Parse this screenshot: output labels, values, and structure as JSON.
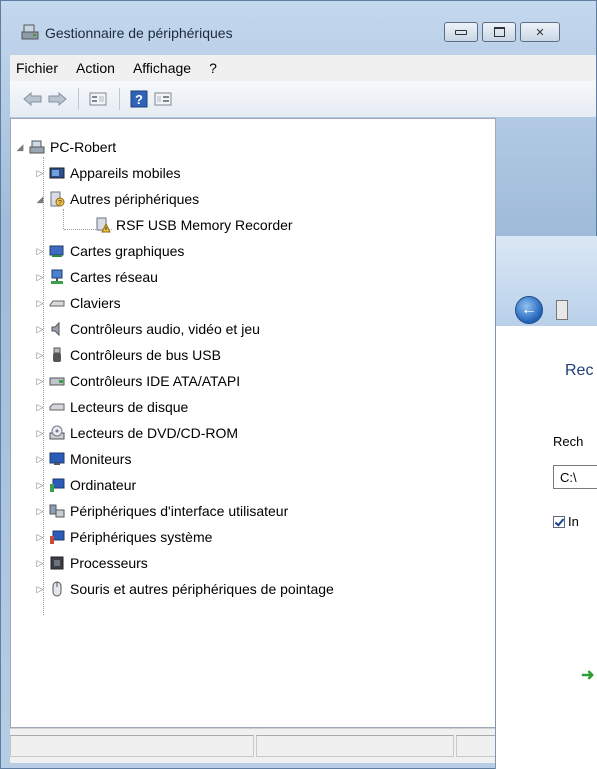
{
  "window": {
    "title": "Gestionnaire de périphériques",
    "buttons": {
      "minimize": "minimize-icon",
      "maximize": "maximize-icon",
      "close": "close-icon"
    }
  },
  "menu": {
    "items": [
      "Fichier",
      "Action",
      "Affichage",
      "?"
    ]
  },
  "toolbar": {
    "icons": [
      "back-arrow-icon",
      "forward-arrow-icon",
      "properties-icon",
      "help-icon",
      "view-icon"
    ]
  },
  "tree": {
    "root": "PC-Robert",
    "items": [
      {
        "label": "Appareils mobiles",
        "icon": "mobile-device-icon",
        "expanded": false
      },
      {
        "label": "Autres périphériques",
        "icon": "unknown-device-icon",
        "expanded": true,
        "children": [
          {
            "label": "RSF USB Memory Recorder",
            "icon": "warning-device-icon"
          }
        ]
      },
      {
        "label": "Cartes graphiques",
        "icon": "display-adapter-icon",
        "expanded": false
      },
      {
        "label": "Cartes réseau",
        "icon": "network-adapter-icon",
        "expanded": false
      },
      {
        "label": "Claviers",
        "icon": "keyboard-icon",
        "expanded": false
      },
      {
        "label": "Contrôleurs audio, vidéo et jeu",
        "icon": "speaker-icon",
        "expanded": false
      },
      {
        "label": "Contrôleurs de bus USB",
        "icon": "usb-icon",
        "expanded": false
      },
      {
        "label": "Contrôleurs IDE ATA/ATAPI",
        "icon": "ide-controller-icon",
        "expanded": false
      },
      {
        "label": "Lecteurs de disque",
        "icon": "disk-drive-icon",
        "expanded": false
      },
      {
        "label": "Lecteurs de DVD/CD-ROM",
        "icon": "dvd-drive-icon",
        "expanded": false
      },
      {
        "label": "Moniteurs",
        "icon": "monitor-icon",
        "expanded": false
      },
      {
        "label": "Ordinateur",
        "icon": "computer-icon",
        "expanded": false
      },
      {
        "label": "Périphériques d'interface utilisateur",
        "icon": "hid-icon",
        "expanded": false
      },
      {
        "label": "Périphériques système",
        "icon": "system-device-icon",
        "expanded": false
      },
      {
        "label": "Processeurs",
        "icon": "processor-icon",
        "expanded": false
      },
      {
        "label": "Souris et autres périphériques de pointage",
        "icon": "mouse-icon",
        "expanded": false
      }
    ]
  },
  "dialog": {
    "title": "Rec",
    "label": "Rech",
    "path_value": "C:\\",
    "checkbox_label": "In",
    "checkbox_checked": true
  },
  "colors": {
    "title_bar": "#b7cde6",
    "dialog_title": "#1e3f7a",
    "link_arrow": "#2e9e32"
  }
}
